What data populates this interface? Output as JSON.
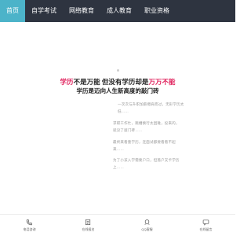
{
  "nav": {
    "items": [
      {
        "label": "首页",
        "active": true
      },
      {
        "label": "自学考试",
        "active": false
      },
      {
        "label": "网络教育",
        "active": false
      },
      {
        "label": "成人教育",
        "active": false
      },
      {
        "label": "职业资格",
        "active": false
      }
    ]
  },
  "headline": {
    "part1": "学历",
    "part2": "不是万能 但没有学历却是",
    "part3": "万万不能"
  },
  "subhead": "学历是迈向人生新高度的敲门砖",
  "paragraphs": [
    "一次次与升职加薪擦肩而过，无形学历太低……",
    "求职工作忙，跳槽换行太困难，投来的，就没了敲门砖……",
    "最终来看重学历，连面试都要看看不起来……",
    "为了小孩入学需要户口，但落户又卡学历上……"
  ],
  "bottom_tabs": [
    {
      "label": "电话咨询",
      "icon": "phone-icon"
    },
    {
      "label": "在线报名",
      "icon": "edit-icon"
    },
    {
      "label": "QQ客服",
      "icon": "qq-icon"
    },
    {
      "label": "在线留言",
      "icon": "message-icon"
    }
  ],
  "colors": {
    "nav_bg": "#2e3440",
    "nav_active": "#4cb3c9",
    "accent_red": "#e0245e"
  }
}
